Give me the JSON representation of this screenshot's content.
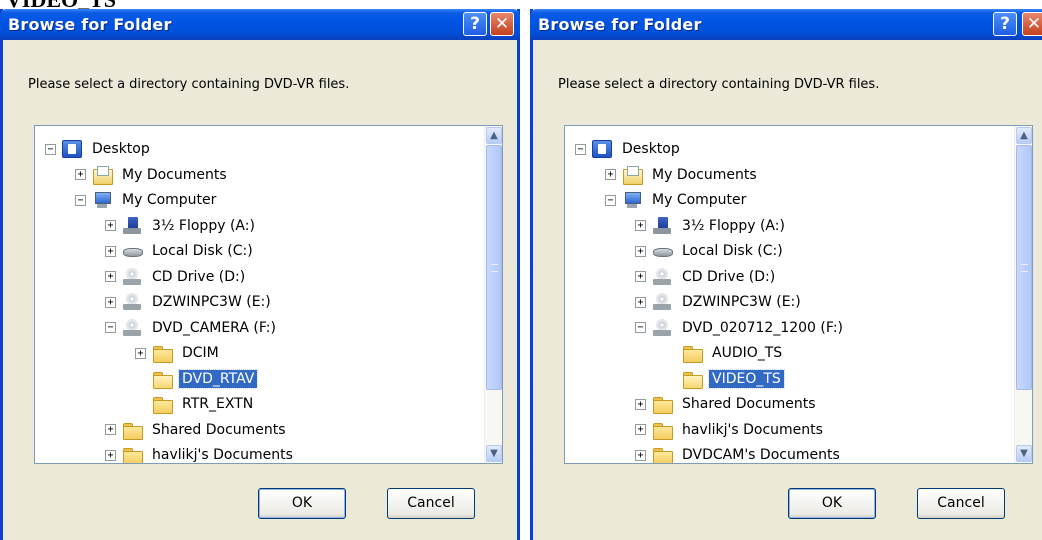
{
  "page_heading": "VIDEO_TS",
  "dialogs": [
    {
      "title": "Browse for Folder",
      "help_label": "?",
      "close_label": "✕",
      "instruction": "Please select a directory containing DVD-VR files.",
      "tree": [
        {
          "label": "Desktop",
          "expander": "−",
          "icon": "desktop-icon",
          "selected": false
        },
        {
          "label": "My Documents",
          "expander": "+",
          "icon": "my-documents-icon",
          "selected": false
        },
        {
          "label": "My Computer",
          "expander": "−",
          "icon": "my-computer-icon",
          "selected": false
        },
        {
          "label": "3½ Floppy (A:)",
          "expander": "+",
          "icon": "floppy-drive-icon",
          "selected": false
        },
        {
          "label": "Local Disk (C:)",
          "expander": "+",
          "icon": "hard-disk-icon",
          "selected": false
        },
        {
          "label": "CD Drive (D:)",
          "expander": "+",
          "icon": "cd-drive-icon",
          "selected": false
        },
        {
          "label": "DZWINPC3W (E:)",
          "expander": "+",
          "icon": "cd-drive-icon",
          "selected": false
        },
        {
          "label": "DVD_CAMERA (F:)",
          "expander": "−",
          "icon": "cd-drive-icon",
          "selected": false
        },
        {
          "label": "DCIM",
          "expander": "+",
          "icon": "folder-icon",
          "selected": false
        },
        {
          "label": "DVD_RTAV",
          "expander": "",
          "icon": "open-folder-icon",
          "selected": true
        },
        {
          "label": "RTR_EXTN",
          "expander": "",
          "icon": "folder-icon",
          "selected": false
        },
        {
          "label": "Shared Documents",
          "expander": "+",
          "icon": "folder-icon",
          "selected": false
        },
        {
          "label": "havlikj's Documents",
          "expander": "+",
          "icon": "folder-icon",
          "selected": false
        }
      ],
      "ok_label": "OK",
      "cancel_label": "Cancel"
    },
    {
      "title": "Browse for Folder",
      "help_label": "?",
      "close_label": "✕",
      "instruction": "Please select a directory containing DVD-VR files.",
      "tree": [
        {
          "label": "Desktop",
          "expander": "−",
          "icon": "desktop-icon",
          "selected": false
        },
        {
          "label": "My Documents",
          "expander": "+",
          "icon": "my-documents-icon",
          "selected": false
        },
        {
          "label": "My Computer",
          "expander": "−",
          "icon": "my-computer-icon",
          "selected": false
        },
        {
          "label": "3½ Floppy (A:)",
          "expander": "+",
          "icon": "floppy-drive-icon",
          "selected": false
        },
        {
          "label": "Local Disk (C:)",
          "expander": "+",
          "icon": "hard-disk-icon",
          "selected": false
        },
        {
          "label": "CD Drive (D:)",
          "expander": "+",
          "icon": "cd-drive-icon",
          "selected": false
        },
        {
          "label": "DZWINPC3W (E:)",
          "expander": "+",
          "icon": "cd-drive-icon",
          "selected": false
        },
        {
          "label": "DVD_020712_1200 (F:)",
          "expander": "−",
          "icon": "cd-drive-icon",
          "selected": false
        },
        {
          "label": "AUDIO_TS",
          "expander": "",
          "icon": "folder-icon",
          "selected": false
        },
        {
          "label": "VIDEO_TS",
          "expander": "",
          "icon": "open-folder-icon",
          "selected": true
        },
        {
          "label": "Shared Documents",
          "expander": "+",
          "icon": "folder-icon",
          "selected": false
        },
        {
          "label": "havlikj's Documents",
          "expander": "+",
          "icon": "folder-icon",
          "selected": false
        },
        {
          "label": "DVDCAM's Documents",
          "expander": "+",
          "icon": "folder-icon",
          "selected": false
        }
      ],
      "ok_label": "OK",
      "cancel_label": "Cancel"
    }
  ],
  "colors": {
    "titlebar": "#0054e3",
    "selection": "#316ac5",
    "dialog_face": "#ece9d8"
  }
}
